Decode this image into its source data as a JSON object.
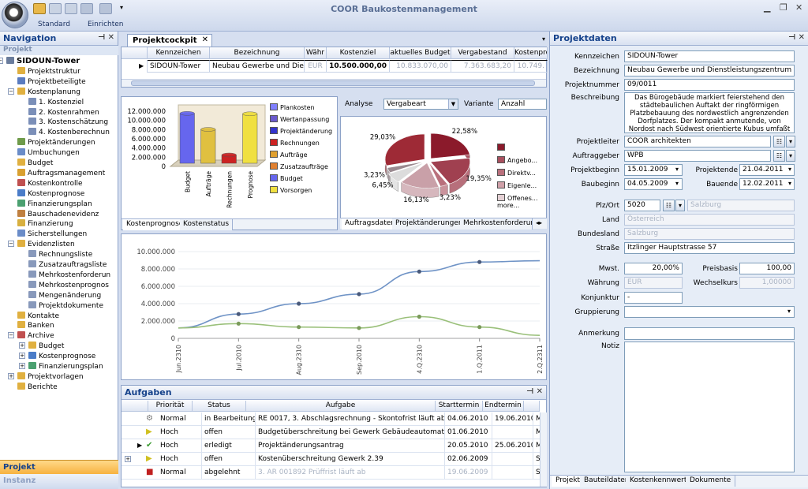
{
  "app": {
    "title": "COOR Baukostenmanagement",
    "toolbar_groups": [
      "Standard",
      "Einrichten"
    ]
  },
  "navigation": {
    "header": "Navigation",
    "section": "Projekt",
    "items": [
      {
        "label": "SIDOUN-Tower"
      },
      {
        "label": "Projektstruktur"
      },
      {
        "label": "Projektbeteiligte"
      },
      {
        "label": "Kostenplanung"
      },
      {
        "label": "1. Kostenziel"
      },
      {
        "label": "2. Kostenrahmen"
      },
      {
        "label": "3. Kostenschätzung"
      },
      {
        "label": "4. Kostenberechnun"
      },
      {
        "label": "Projektänderungen"
      },
      {
        "label": "Umbuchungen"
      },
      {
        "label": "Budget"
      },
      {
        "label": "Auftragsmanagement"
      },
      {
        "label": "Kostenkontrolle"
      },
      {
        "label": "Kostenprognose"
      },
      {
        "label": "Finanzierungsplan"
      },
      {
        "label": "Bauschadenevidenz"
      },
      {
        "label": "Finanzierung"
      },
      {
        "label": "Sicherstellungen"
      },
      {
        "label": "Evidenzlisten"
      },
      {
        "label": "Rechnungsliste"
      },
      {
        "label": "Zusatzauftragsliste"
      },
      {
        "label": "Mehrkostenforderun"
      },
      {
        "label": "Mehrkostenprognos"
      },
      {
        "label": "Mengenänderung"
      },
      {
        "label": "Projektdokumente"
      },
      {
        "label": "Kontakte"
      },
      {
        "label": "Banken"
      },
      {
        "label": "Archive"
      },
      {
        "label": "Budget"
      },
      {
        "label": "Kostenprognose"
      },
      {
        "label": "Finanzierungsplan"
      },
      {
        "label": "Projektvorlagen"
      },
      {
        "label": "Berichte"
      }
    ],
    "bottom_active": "Projekt",
    "bottom_other": "Instanz"
  },
  "cockpit": {
    "tab": "Projektcockpit",
    "columns": [
      "Kennzeichen",
      "Bezeichnung",
      "Währ",
      "Kostenziel",
      "aktuelles Budget",
      "Vergabestand",
      "Kostenprog"
    ],
    "row": [
      "SIDOUN-Tower",
      "Neubau Gewerbe und Dien",
      "EUR",
      "10.500.000,00",
      "10.833.070,00",
      "7.363.683,20",
      "10.749."
    ]
  },
  "chart_bar": {
    "tabs": [
      "Kostenprognose",
      "Kostenstatus"
    ],
    "yticks": [
      "12.000.000",
      "10.000.000",
      "8.000.000",
      "6.000.000",
      "4.000.000",
      "2.000.000",
      "0"
    ],
    "legend": [
      {
        "label": "Plankosten",
        "color": "#8080ff"
      },
      {
        "label": "Wertanpassung",
        "color": "#6a5acd"
      },
      {
        "label": "Projektänderung",
        "color": "#3333cc"
      },
      {
        "label": "Rechnungen",
        "color": "#cc2222"
      },
      {
        "label": "Aufträge",
        "color": "#e0a030"
      },
      {
        "label": "Zusatzaufträge",
        "color": "#e08030"
      },
      {
        "label": "Budget",
        "color": "#6666ee"
      },
      {
        "label": "Vorsorgen",
        "color": "#f0e040"
      }
    ],
    "chart_data": {
      "type": "bar",
      "categories": [
        "Budget",
        "Aufträge",
        "Rechnungen",
        "Prognose"
      ],
      "values": [
        10833070,
        7363683,
        1800000,
        10749000
      ],
      "colors": [
        "#6666ee",
        "#e0c040",
        "#cc2222",
        "#f0e040"
      ],
      "ylim": [
        0,
        12000000
      ]
    }
  },
  "chart_pie": {
    "analyse_label": "Analyse",
    "analyse_value": "Vergabeart",
    "variante_label": "Variante",
    "variante_value": "Anzahl",
    "tabs": [
      "Auftragsdaten",
      "Projektänderungen",
      "Mehrkostenforderung"
    ],
    "legend": [
      {
        "label": "",
        "color": "#8b1a2b"
      },
      {
        "label": "Angebo...",
        "color": "#a8505e"
      },
      {
        "label": "Direktv...",
        "color": "#b9707c"
      },
      {
        "label": "Eigenle...",
        "color": "#cfa0a8"
      },
      {
        "label": "Offenes... more...",
        "color": "#e4d0d4"
      }
    ],
    "chart_data": {
      "type": "pie",
      "labels": [
        "22,58%",
        "19,35%",
        "3,23%",
        "16,13%",
        "6,45%",
        "3,23%",
        "29,03%"
      ],
      "values": [
        22.58,
        19.35,
        3.23,
        16.13,
        6.45,
        3.23,
        29.03
      ],
      "colors": [
        "#8b1a2b",
        "#a04050",
        "#b9707c",
        "#c9a0a8",
        "#dcdcdc",
        "#9a8a90",
        "#9e2a36"
      ]
    }
  },
  "chart_line": {
    "yticks": [
      "10.000.000",
      "8.000.000",
      "6.000.000",
      "4.000.000",
      "2.000.000",
      "0"
    ],
    "xticks": [
      "Jun.2310",
      "Jul.2010",
      "Aug.2310",
      "Sep.2010",
      "4.Q.2310",
      "1.Q.2011",
      "2.Q.2311"
    ],
    "chart_data": {
      "type": "line",
      "x": [
        "Jun.2310",
        "Jul.2010",
        "Aug.2310",
        "Sep.2010",
        "4.Q.2310",
        "1.Q.2011",
        "2.Q.2311"
      ],
      "series": [
        {
          "values": [
            1200000,
            2800000,
            4000000,
            5100000,
            7700000,
            8800000,
            8950000
          ],
          "color": "#6f93c6"
        },
        {
          "values": [
            1200000,
            1700000,
            1300000,
            1200000,
            2500000,
            1300000,
            350000
          ],
          "color": "#9ac07a"
        }
      ],
      "ylim": [
        0,
        10500000
      ]
    }
  },
  "tasks": {
    "header": "Aufgaben",
    "columns": [
      "Priorität",
      "Status",
      "Aufgabe",
      "Starttermin",
      "Endtermin",
      ""
    ],
    "rows": [
      {
        "icon": "gear",
        "prio": "Normal",
        "status": "in Bearbeitung",
        "task": "RE 0017, 3. Abschlagsrechnung - Skontofrist läuft ab!",
        "start": "04.06.2010",
        "end": "19.06.2010",
        "more": "Me"
      },
      {
        "icon": "play",
        "prio": "Hoch",
        "status": "offen",
        "task": "Budgetüberschreitung bei Gewerk Gebäudeautomation",
        "start": "01.06.2010",
        "end": "",
        "more": "Me"
      },
      {
        "icon": "check",
        "prio": "Hoch",
        "status": "erledigt",
        "task": "Projektänderungsantrag",
        "start": "20.05.2010",
        "end": "25.06.2010",
        "more": "Me"
      },
      {
        "icon": "play",
        "prio": "Hoch",
        "status": "offen",
        "task": "Kostenüberschreitung Gewerk 2.39",
        "start": "02.06.2009",
        "end": "",
        "more": "Sta"
      },
      {
        "icon": "stop",
        "prio": "Normal",
        "status": "abgelehnt",
        "task": "3. AR 001892 Prüffrist läuft ab",
        "start": "19.06.2009",
        "end": "",
        "more": "Sta"
      }
    ]
  },
  "projektdaten": {
    "header": "Projektdaten",
    "kennzeichen_label": "Kennzeichen",
    "kennzeichen": "SIDOUN-Tower",
    "bezeichnung_label": "Bezeichnung",
    "bezeichnung": "Neubau Gewerbe und Dienstleistungszentrum",
    "projektnummer_label": "Projektnummer",
    "projektnummer": "09/0011",
    "beschreibung_label": "Beschreibung",
    "beschreibung": "Das Bürogebäude markiert feierstehend den städtebaulichen Auftakt der ringförmigen Platzbebauung des nordwestlich angrenzenden Dorfplatzes. Der kompakt anmutende, von Nordost nach Südwest orientierte Kubus umfaßt eine Grundl",
    "projektleiter_label": "Projektleiter",
    "projektleiter": "COOR architekten",
    "auftraggeber_label": "Auftraggeber",
    "auftraggeber": "WPB",
    "projektbeginn_label": "Projektbeginn",
    "projektbeginn": "15.01.2009",
    "projektende_label": "Projektende",
    "projektende": "21.04.2011",
    "baubeginn_label": "Baubeginn",
    "baubeginn": "04.05.2009",
    "bauende_label": "Bauende",
    "bauende": "12.02.2011",
    "plz_label": "Plz/Ort",
    "plz": "5020",
    "ort": "Salzburg",
    "land_label": "Land",
    "land": "Österreich",
    "bundesland_label": "Bundesland",
    "bundesland": "Salzburg",
    "strasse_label": "Straße",
    "strasse": "Itzlinger Hauptstrasse 57",
    "mwst_label": "Mwst.",
    "mwst": "20,00%",
    "preisbasis_label": "Preisbasis",
    "preisbasis": "100,00",
    "waehrung_label": "Währung",
    "waehrung": "EUR",
    "wechselkurs_label": "Wechselkurs",
    "wechselkurs": "1,00000",
    "konjunktur_label": "Konjunktur",
    "konjunktur": "-",
    "gruppierung_label": "Gruppierung",
    "gruppierung": "",
    "anmerkung_label": "Anmerkung",
    "notiz_label": "Notiz",
    "tabs": [
      "Projekt",
      "Bauteildaten",
      "Kostenkennwerte",
      "Dokumente"
    ]
  }
}
